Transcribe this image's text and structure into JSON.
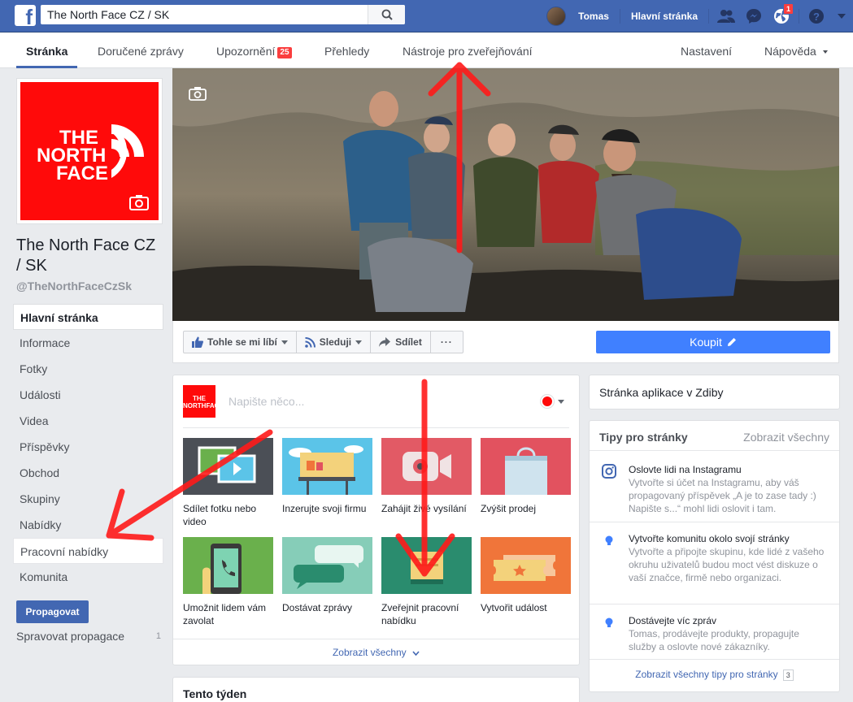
{
  "topbar": {
    "search_value": "The North Face CZ / SK",
    "user_name": "Tomas",
    "home_label": "Hlavní stránka",
    "notif_badge": "1"
  },
  "tabs": [
    {
      "label": "Stránka",
      "active": true
    },
    {
      "label": "Doručené zprávy"
    },
    {
      "label": "Upozornění",
      "badge": "25"
    },
    {
      "label": "Přehledy"
    },
    {
      "label": "Nástroje pro zveřejňování"
    },
    {
      "label": "Nastavení"
    },
    {
      "label": "Nápověda"
    }
  ],
  "page": {
    "logo_text": [
      "THE",
      "NORTH",
      "FACE"
    ],
    "name": "The North Face CZ / SK",
    "handle": "@TheNorthFaceCzSk"
  },
  "leftnav": [
    "Hlavní stránka",
    "Informace",
    "Fotky",
    "Události",
    "Videa",
    "Příspěvky",
    "Obchod",
    "Skupiny",
    "Nabídky",
    "Pracovní nabídky",
    "Komunita"
  ],
  "promote": {
    "button": "Propagovat",
    "manage": "Spravovat propagace",
    "count": "1"
  },
  "actions": {
    "like": "Tohle se mi líbí",
    "follow": "Sleduji",
    "share": "Sdílet",
    "more": "···",
    "buy": "Koupit"
  },
  "composer": {
    "placeholder": "Napište něco...",
    "tiles": [
      {
        "label": "Sdílet fotku nebo video",
        "color": "#4b4f56"
      },
      {
        "label": "Inzerujte svoji firmu",
        "color": "#5bc4e8"
      },
      {
        "label": "Zahájit živé vysílání",
        "color": "#e25a65"
      },
      {
        "label": "Zvýšit prodej",
        "color": "#e2525f"
      },
      {
        "label": "Umožnit lidem vám zavolat",
        "color": "#6ab04c"
      },
      {
        "label": "Dostávat zprávy",
        "color": "#86cdb8"
      },
      {
        "label": "Zveřejnit pracovní nabídku",
        "color": "#2a8c6e"
      },
      {
        "label": "Vytvořit událost",
        "color": "#f0753a"
      }
    ],
    "show_all": "Zobrazit všechny"
  },
  "week": {
    "title": "Tento týden"
  },
  "app_card": {
    "title": "Stránka aplikace v Zdiby"
  },
  "tips": {
    "title": "Tipy pro stránky",
    "show_all": "Zobrazit všechny",
    "items": [
      {
        "title": "Oslovte lidi na Instagramu",
        "desc": "Vytvořte si účet na Instagramu, aby váš propagovaný příspěvek „A je to zase tady :) Napište s...“ mohl lidi oslovit i tam.",
        "icon": "instagram-icon"
      },
      {
        "title": "Vytvořte komunitu okolo svojí stránky",
        "desc": "Vytvořte a připojte skupinu, kde lidé z vašeho okruhu uživatelů budou moct vést diskuze o vaší značce, firmě nebo organizaci.",
        "icon": "lightbulb-icon"
      },
      {
        "title": "Dostávejte víc zpráv",
        "desc": "Tomas, prodávejte produkty, propagujte služby a oslovte nové zákazníky.",
        "icon": "lightbulb-icon"
      }
    ],
    "footer": "Zobrazit všechny tipy pro stránky",
    "footer_count": "3"
  },
  "colors": {
    "fb_blue": "#4267b2",
    "buy_blue": "#4080ff",
    "annotation_red": "#ff1a1a",
    "brand_red": "#ff0a0a"
  }
}
